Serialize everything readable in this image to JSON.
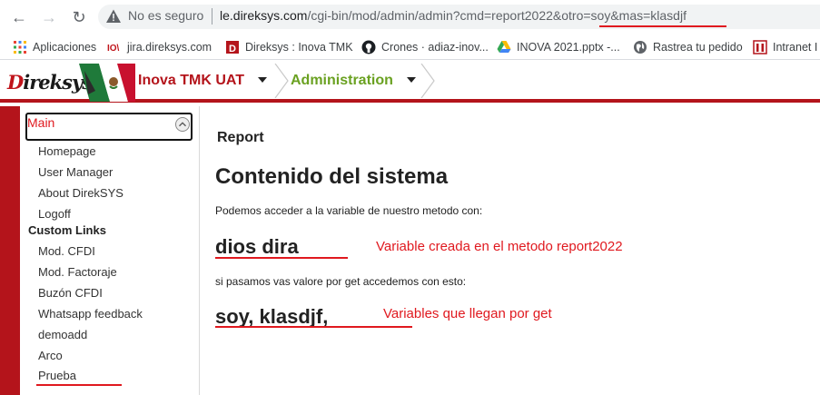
{
  "browser": {
    "not_secure": "No es seguro",
    "url_host": "le.direksys.com",
    "url_path": "/cgi-bin/mod/admin/admin?cmd=report2022&otro=soy&mas=klasdjf",
    "bookmarks": [
      {
        "label": "Aplicaciones",
        "icon": "apps-grid-icon"
      },
      {
        "label": "jira.direksys.com",
        "icon": "jira-icon"
      },
      {
        "label": "Direksys : Inova TMK",
        "icon": "direksys-icon"
      },
      {
        "label": "Crones · adiaz-inov...",
        "icon": "github-icon"
      },
      {
        "label": "INOVA 2021.pptx -...",
        "icon": "drive-icon"
      },
      {
        "label": "Rastrea tu pedido",
        "icon": "globe-icon"
      },
      {
        "label": "Intranet I",
        "icon": "intranet-icon"
      }
    ]
  },
  "header": {
    "logo": "Direksys",
    "app_name": "Inova TMK UAT",
    "module": "Administration"
  },
  "sidebar": {
    "main_label": "Main",
    "main_items": [
      "Homepage",
      "User Manager",
      "About DirekSYS",
      "Logoff"
    ],
    "custom_title": "Custom Links",
    "custom_items": [
      "Mod. CFDI",
      "Mod. Factoraje",
      "Buzón CFDI",
      "Whatsapp feedback",
      "demoadd",
      "Arco",
      "Prueba"
    ]
  },
  "content": {
    "report_label": "Report",
    "title": "Contenido del sistema",
    "text1": "Podemos acceder a la variable de nuestro metodo con:",
    "value1": "dios dira",
    "annotation1": "Variable creada en el metodo report2022",
    "text2": "si pasamos vas valore por get accedemos con esto:",
    "value2": "soy, klasdjf,",
    "annotation2": "Variables que llegan por get"
  },
  "colors": {
    "brand_red": "#b4141b",
    "annotation_red": "#e0191f",
    "admin_green": "#6aa121"
  }
}
